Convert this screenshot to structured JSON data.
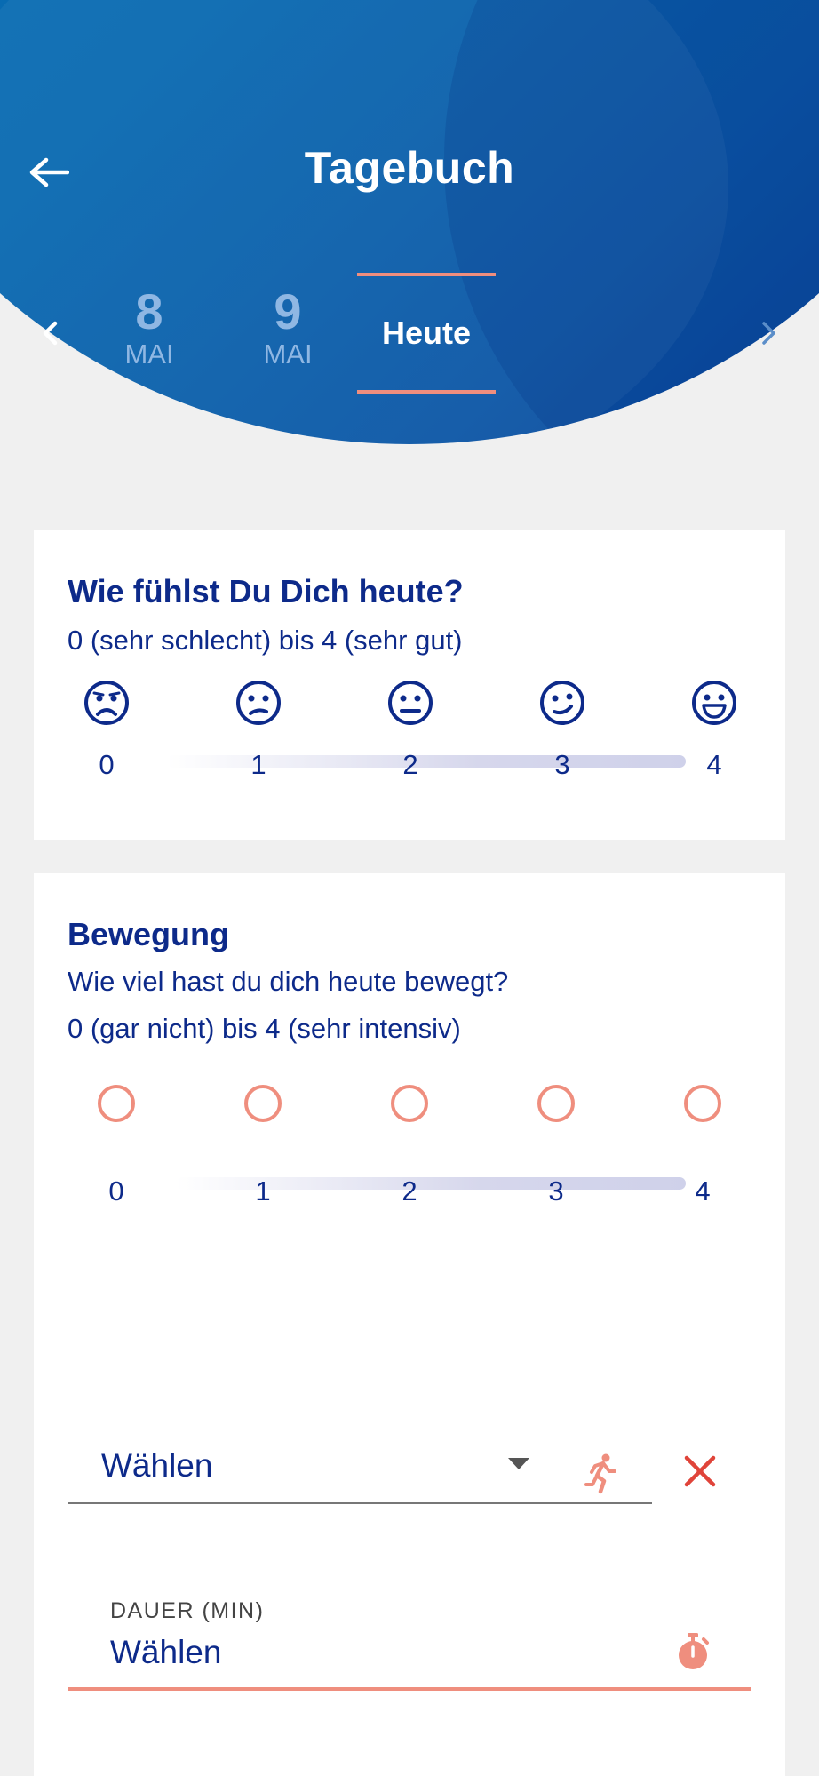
{
  "header": {
    "title": "Tagebuch",
    "dates": [
      {
        "day": "8",
        "month": "MAI"
      },
      {
        "day": "9",
        "month": "MAI"
      }
    ],
    "today_label": "Heute"
  },
  "mood_card": {
    "title": "Wie fühlst Du Dich heute?",
    "subtitle": "0 (sehr schlecht) bis 4 (sehr gut)",
    "scale": [
      "0",
      "1",
      "2",
      "3",
      "4"
    ],
    "icons": [
      "very-sad-face-icon",
      "sad-face-icon",
      "neutral-face-icon",
      "wink-face-icon",
      "happy-face-icon"
    ]
  },
  "movement_card": {
    "title": "Bewegung",
    "question": "Wie viel hast du dich heute bewegt?",
    "subtitle": "0 (gar nicht) bis 4 (sehr intensiv)",
    "scale": [
      "0",
      "1",
      "2",
      "3",
      "4"
    ],
    "activity_select": {
      "value": "Wählen"
    },
    "duration": {
      "label": "DAUER (MIN)",
      "value": "Wählen"
    }
  },
  "colors": {
    "primary": "#0d2a8a",
    "accent": "#ef8e7e",
    "header_blue": "#0869b0",
    "close_red": "#e0443a"
  }
}
